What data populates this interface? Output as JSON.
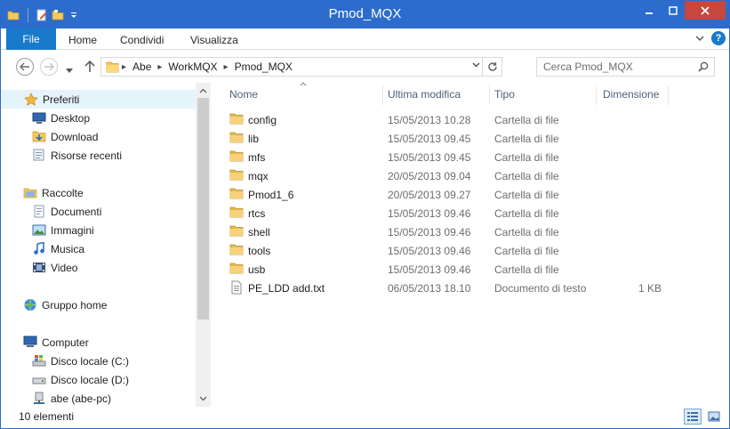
{
  "window": {
    "title": "Pmod_MQX"
  },
  "ribbon": {
    "file_tab": "File",
    "tabs": [
      "Home",
      "Condividi",
      "Visualizza"
    ]
  },
  "nav": {
    "breadcrumbs": [
      "Abe",
      "WorkMQX",
      "Pmod_MQX"
    ],
    "search_placeholder": "Cerca Pmod_MQX"
  },
  "sidebar": {
    "items": [
      {
        "label": "Preferiti",
        "icon": "star-icon",
        "level": 0,
        "selected": true
      },
      {
        "label": "Desktop",
        "icon": "desktop-icon",
        "level": 1
      },
      {
        "label": "Download",
        "icon": "download-folder-icon",
        "level": 1
      },
      {
        "label": "Risorse recenti",
        "icon": "recent-places-icon",
        "level": 1
      },
      {
        "label": "Raccolte",
        "icon": "libraries-icon",
        "level": 0
      },
      {
        "label": "Documenti",
        "icon": "documents-icon",
        "level": 1
      },
      {
        "label": "Immagini",
        "icon": "pictures-icon",
        "level": 1
      },
      {
        "label": "Musica",
        "icon": "music-icon",
        "level": 1
      },
      {
        "label": "Video",
        "icon": "video-icon",
        "level": 1
      },
      {
        "label": "Gruppo home",
        "icon": "homegroup-icon",
        "level": 0
      },
      {
        "label": "Computer",
        "icon": "computer-icon",
        "level": 0
      },
      {
        "label": "Disco locale (C:)",
        "icon": "system-drive-icon",
        "level": 1
      },
      {
        "label": "Disco locale (D:)",
        "icon": "drive-icon",
        "level": 1
      },
      {
        "label": "abe (abe-pc)",
        "icon": "network-drive-icon",
        "level": 1
      }
    ]
  },
  "columns": {
    "name": "Nome",
    "modified": "Ultima modifica",
    "type": "Tipo",
    "size": "Dimensione"
  },
  "files": [
    {
      "name": "config",
      "modified": "15/05/2013 10.28",
      "type": "Cartella di file",
      "size": "",
      "kind": "folder"
    },
    {
      "name": "lib",
      "modified": "15/05/2013 09.45",
      "type": "Cartella di file",
      "size": "",
      "kind": "folder"
    },
    {
      "name": "mfs",
      "modified": "15/05/2013 09.45",
      "type": "Cartella di file",
      "size": "",
      "kind": "folder"
    },
    {
      "name": "mqx",
      "modified": "20/05/2013 09.04",
      "type": "Cartella di file",
      "size": "",
      "kind": "folder"
    },
    {
      "name": "Pmod1_6",
      "modified": "20/05/2013 09.27",
      "type": "Cartella di file",
      "size": "",
      "kind": "folder"
    },
    {
      "name": "rtcs",
      "modified": "15/05/2013 09.46",
      "type": "Cartella di file",
      "size": "",
      "kind": "folder"
    },
    {
      "name": "shell",
      "modified": "15/05/2013 09.46",
      "type": "Cartella di file",
      "size": "",
      "kind": "folder"
    },
    {
      "name": "tools",
      "modified": "15/05/2013 09.46",
      "type": "Cartella di file",
      "size": "",
      "kind": "folder"
    },
    {
      "name": "usb",
      "modified": "15/05/2013 09.46",
      "type": "Cartella di file",
      "size": "",
      "kind": "folder"
    },
    {
      "name": "PE_LDD add.txt",
      "modified": "06/05/2013 18.10",
      "type": "Documento di testo",
      "size": "1 KB",
      "kind": "text"
    }
  ],
  "status": {
    "item_count": "10 elementi"
  },
  "colors": {
    "titlebar": "#2b6ccc",
    "file_tab": "#1979ca",
    "folder": "#e8b94a",
    "header_text": "#4c607a",
    "selection": "#e5f3fb"
  }
}
